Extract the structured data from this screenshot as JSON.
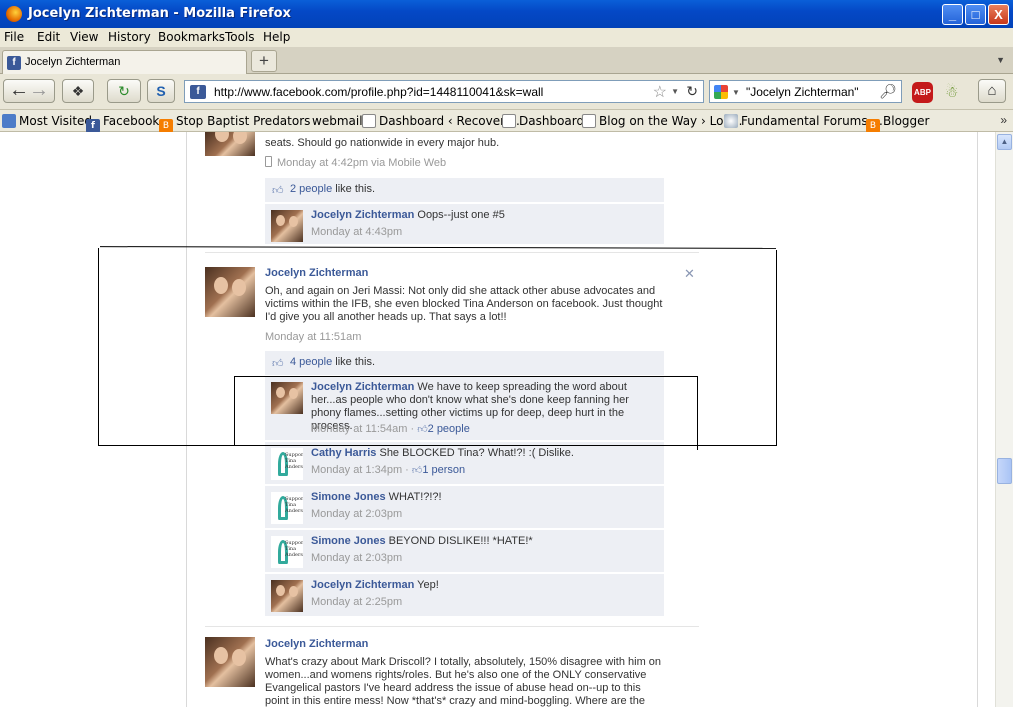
{
  "window": {
    "title": "Jocelyn Zichterman - Mozilla Firefox",
    "min": "_",
    "max": "□",
    "close": "X"
  },
  "menu": [
    "File",
    "Edit",
    "View",
    "History",
    "Bookmarks",
    "Tools",
    "Help"
  ],
  "tab": {
    "label": "Jocelyn Zichterman",
    "new_tab": "+",
    "list_arrow": "▼"
  },
  "nav": {
    "url": "http://www.facebook.com/profile.php?id=1448110041&sk=wall",
    "search": "\"Jocelyn Zichterman\"",
    "abp": "ABP"
  },
  "bookmarks": [
    "Most Visited",
    "Facebook",
    "Stop Baptist Predators",
    "webmail",
    "Dashboard ‹ Recoveri...",
    "Dashboard",
    "Blog on the Way › Log...",
    "Fundamental Forums....",
    "Blogger"
  ],
  "bookmarks_more": "»",
  "feed": {
    "top": {
      "text_tail": "seats. Should go nationwide in every major hub.",
      "time": "Monday at 4:42pm via Mobile Web",
      "likes_link": "2 people",
      "likes_suffix": " like this.",
      "comment": {
        "name": "Jocelyn Zichterman",
        "text": " Oops--just one #5",
        "time": "Monday at 4:43pm"
      }
    },
    "post1": {
      "name": "Jocelyn Zichterman",
      "text": "Oh, and again on Jeri Massi: Not only did she attack other abuse advocates and victims within the IFB, she even blocked Tina Anderson on facebook. Just thought I'd give you all another heads up. That says a lot!!",
      "time": "Monday at 11:51am",
      "likes_link": "4 people",
      "likes_suffix": " like this.",
      "comments": [
        {
          "name": "Jocelyn Zichterman",
          "text": " We have to keep spreading the word about her...as people who don't know what she's done keep fanning her phony flames...setting other victims up for deep, deep hurt in the process.",
          "time": "Monday at 11:54am · ",
          "likes": "2 people"
        },
        {
          "name": "Cathy Harris",
          "text": " She BLOCKED Tina? What!?! :( Dislike.",
          "time": "Monday at 1:34pm · ",
          "likes": "1 person"
        },
        {
          "name": "Simone Jones",
          "text": " WHAT!?!?!",
          "time": "Monday at 2:03pm",
          "likes": ""
        },
        {
          "name": "Simone Jones",
          "text": " BEYOND DISLIKE!!! *HATE!*",
          "time": "Monday at 2:03pm",
          "likes": ""
        },
        {
          "name": "Jocelyn Zichterman",
          "text": " Yep!",
          "time": "Monday at 2:25pm",
          "likes": ""
        }
      ]
    },
    "post2": {
      "name": "Jocelyn Zichterman",
      "text": "What's crazy about Mark Driscoll? I totally, absolutely, 150% disagree with him on women...and womens rights/roles. But he's also one of the ONLY conservative Evangelical pastors I've heard address the issue of abuse head on--up to this point in this entire mess! Now *that's* crazy and mind-boggling. Where are the MEN"
    },
    "ribbon_text": "Support Tina Anderson"
  },
  "colors": {
    "fb_blue": "#3b5998",
    "comment_bg": "#edeff4",
    "xp_blue": "#0448c6"
  }
}
